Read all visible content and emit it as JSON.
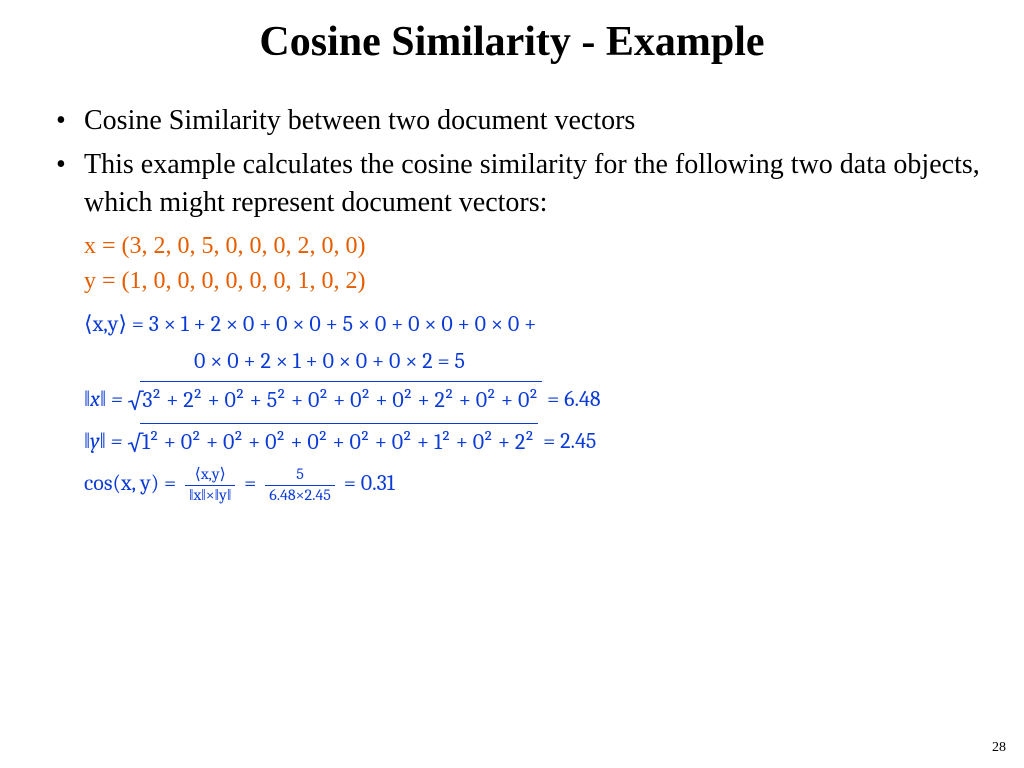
{
  "title": "Cosine Similarity - Example",
  "bullets": {
    "b1": "Cosine Similarity between two document vectors",
    "b2": "This example calculates the cosine similarity for the following two data objects, which might represent document vectors:"
  },
  "vectors": {
    "x": "x = (3, 2, 0, 5, 0, 0, 0, 2, 0, 0)",
    "y": "y = (1, 0, 0, 0, 0, 0, 0, 1, 0, 2)"
  },
  "math": {
    "dot_label": "⟨x,y⟩ =",
    "dot_line1": "3 × 1 + 2 × 0 + 0 × 0 + 5 × 0 + 0 × 0 + 0 × 0 +",
    "dot_line2": "0 × 0 + 2 × 1 + 0 × 0 + 0 × 2 = 5",
    "normx_label": "‖x‖ =",
    "normx_sqrt": "3² + 2² + 0² + 5² + 0² + 0² + 0² + 2² + 0² + 0²",
    "normx_result": " = 6.48",
    "normy_label": "‖y‖ =",
    "normy_sqrt": "1² + 0² + 0² + 0² + 0² + 0² + 0² + 1² + 0² + 2²",
    "normy_result": " = 2.45",
    "cos_label": "cos(x, y) =",
    "frac1_num": "⟨x,y⟩",
    "frac1_den": "‖x‖×‖y‖",
    "eq": " = ",
    "frac2_num": "5",
    "frac2_den": "6.48×2.45",
    "cos_result": " = 0.31"
  },
  "page": "28"
}
